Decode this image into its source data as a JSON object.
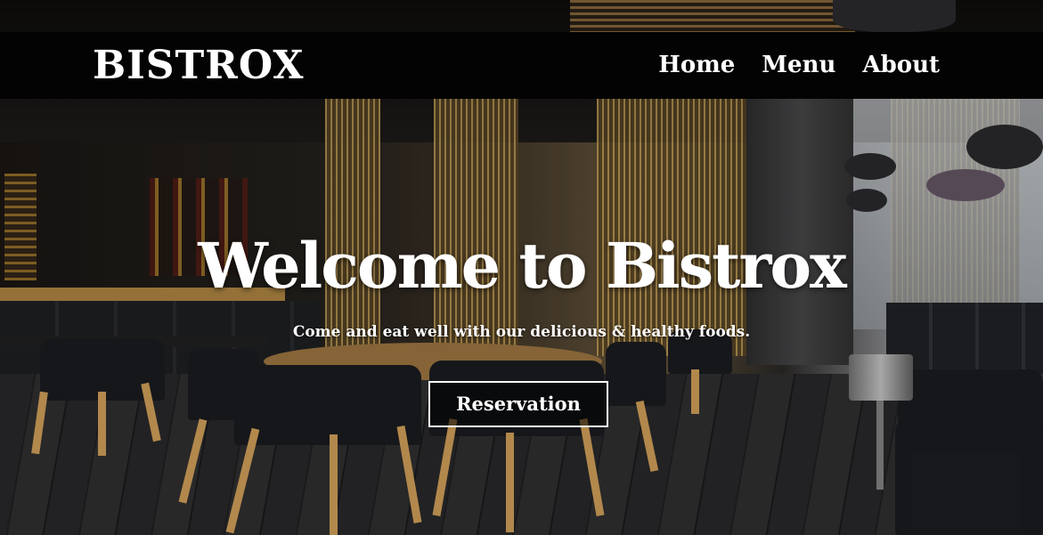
{
  "brand": {
    "name": "BISTROX"
  },
  "nav": {
    "items": [
      "Home",
      "Menu",
      "About"
    ]
  },
  "hero": {
    "title": "Welcome to Bistrox",
    "subtitle": "Come and eat well with our delicious & healthy foods.",
    "button_label": "Reservation"
  },
  "colors": {
    "header_bg": "#030303",
    "text": "#ffffff",
    "button_border": "#ffffff"
  }
}
